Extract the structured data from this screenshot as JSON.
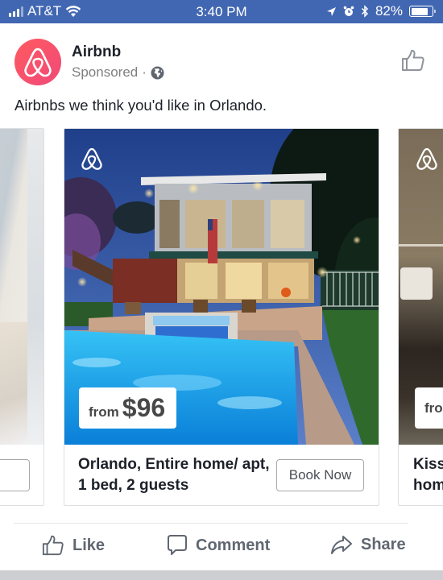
{
  "status_bar": {
    "carrier": "AT&T",
    "time": "3:40 PM",
    "battery_percent": "82%",
    "battery_level": 0.82,
    "icons": [
      "signal-icon",
      "wifi-icon",
      "location-icon",
      "alarm-icon",
      "bluetooth-icon",
      "battery-icon"
    ]
  },
  "post": {
    "page_name": "Airbnb",
    "sponsored_label": "Sponsored",
    "separator": "·",
    "caption": "Airbnbs we think you'd like in Orlando.",
    "accent_color": "#ff5a5f"
  },
  "carousel": {
    "cards": [
      {
        "title": "",
        "button_label": "Book Now",
        "visible_button_fragment": "ow"
      },
      {
        "price_prefix": "from",
        "price": "$96",
        "title": "Orlando, Entire home/ apt, 1 bed, 2 guests",
        "button_label": "Book Now"
      },
      {
        "price_prefix": "fro",
        "title_line1": "Kiss",
        "title_line2": "hom"
      }
    ]
  },
  "actions": {
    "like": "Like",
    "comment": "Comment",
    "share": "Share"
  }
}
